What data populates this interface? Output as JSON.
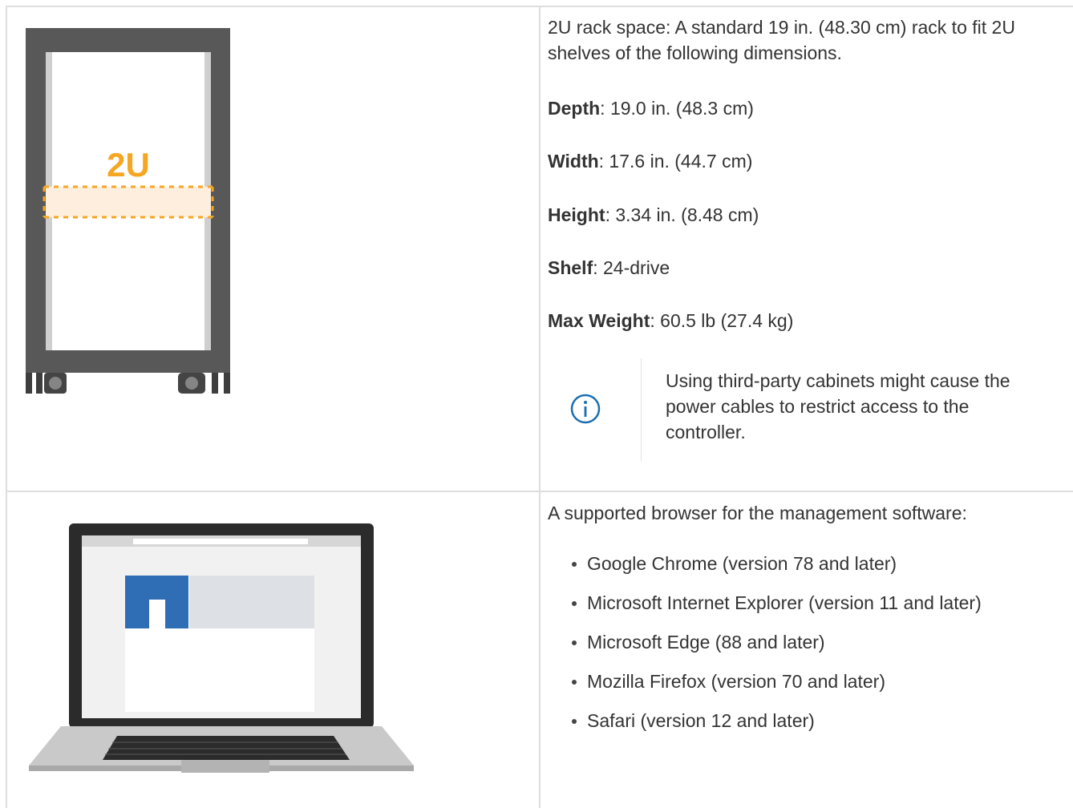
{
  "rack": {
    "illustration_label": "2U",
    "intro": "2U rack space: A standard 19 in. (48.30 cm) rack to fit 2U shelves of the following dimensions.",
    "specs": [
      {
        "label": "Depth",
        "value": ": 19.0 in. (48.3 cm)"
      },
      {
        "label": "Width",
        "value": ": 17.6 in. (44.7 cm)"
      },
      {
        "label": "Height",
        "value": ": 3.34 in. (8.48 cm)"
      },
      {
        "label": "Shelf",
        "value": ": 24-drive"
      },
      {
        "label": "Max Weight",
        "value": ": 60.5 lb (27.4 kg)"
      }
    ],
    "note": {
      "icon": "info-icon",
      "text": "Using third-party cabinets might cause the power cables to restrict access to the controller."
    }
  },
  "browser": {
    "intro": "A supported browser for the management software:",
    "items": [
      "Google Chrome (version 78 and later)",
      "Microsoft Internet Explorer (version 11 and later)",
      "Microsoft Edge (88 and later)",
      "Mozilla Firefox (version 70 and later)",
      "Safari (version 12 and later)"
    ]
  },
  "colors": {
    "border": "#dedede",
    "text": "#333333",
    "accent_orange": "#f5a623",
    "logo_blue": "#2f6eb5",
    "info_blue": "#1a6fb0"
  }
}
